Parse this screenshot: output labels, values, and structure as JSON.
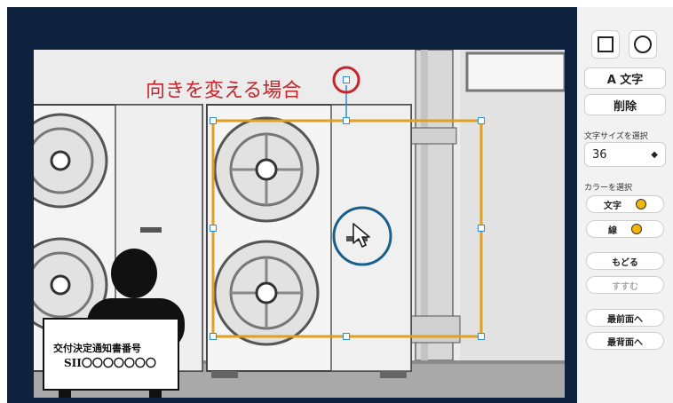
{
  "canvas": {
    "caption": "向きを変える場合",
    "sign_title": "交付決定通知書番号",
    "sign_code": "SII〇〇〇〇〇〇〇"
  },
  "panel": {
    "text_button": "A 文字",
    "delete_button": "削除",
    "font_size_label": "文字サイズを選択",
    "font_size_value": "36",
    "color_label": "カラーを選択",
    "text_color_label": "文字",
    "line_color_label": "線",
    "undo_button": "もどる",
    "redo_button": "すすむ",
    "bring_front_button": "最前面へ",
    "send_back_button": "最背面へ"
  },
  "colors": {
    "canvas_bg": "#0e2240",
    "caption": "#c4262e",
    "selection_frame": "#e0a020",
    "handle": "#2a8fd6",
    "swatch_text": "#f2b705",
    "swatch_line": "#f2b705",
    "highlight_circle": "#1a5e8c"
  },
  "icons": [
    "square-icon",
    "circle-icon",
    "select-arrow-icon",
    "mouse-cursor-icon"
  ]
}
